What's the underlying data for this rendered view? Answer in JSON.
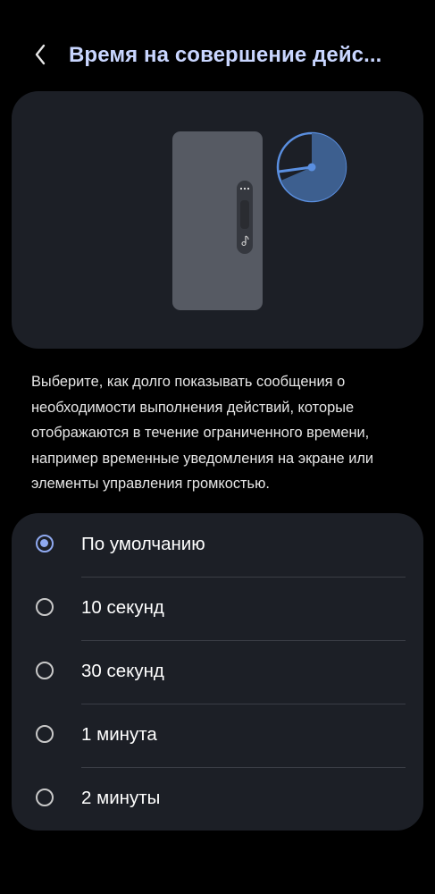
{
  "header": {
    "title": "Время на совершение дейс...",
    "back_icon": "chevron-left-icon"
  },
  "illustration": {
    "phone": "phone-screen",
    "volume_panel_icons": [
      "more-dots-icon",
      "music-note-icon"
    ],
    "timer_icon": "timer-pie-icon",
    "timer_color": "#3d5f8f",
    "timer_outline": "#5a8fe0"
  },
  "description": "Выберите, как долго показывать сообщения о необходимости выполнения действий, которые отображаются в течение ограниченного времени, например временные уведомления на экране или элементы управления громкостью.",
  "options": [
    {
      "label": "По умолчанию",
      "selected": true
    },
    {
      "label": "10 секунд",
      "selected": false
    },
    {
      "label": "30 секунд",
      "selected": false
    },
    {
      "label": "1 минута",
      "selected": false
    },
    {
      "label": "2 минуты",
      "selected": false
    }
  ],
  "colors": {
    "accent": "#8fa9f0",
    "title": "#c9d6ff",
    "card": "#1c1f26"
  }
}
